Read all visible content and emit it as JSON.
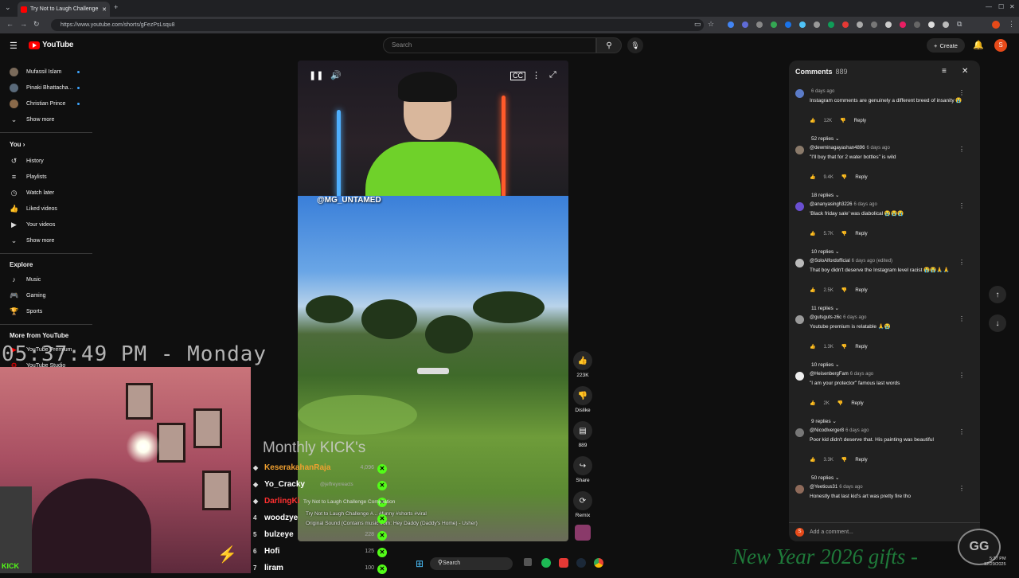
{
  "browser": {
    "tab_title": "Try Not to Laugh Challenge",
    "url": "https://www.youtube.com/shorts/gFezPsLsqu8",
    "win_controls": [
      "—",
      "☐",
      "✕"
    ]
  },
  "youtube": {
    "logo_text": "YouTube",
    "search_placeholder": "Search",
    "create_label": "Create",
    "avatar_letter": "S"
  },
  "sidebar": {
    "subs": [
      {
        "label": "Mufassil Islam"
      },
      {
        "label": "Pinaki Bhattacha..."
      },
      {
        "label": "Christian Prince"
      }
    ],
    "show_more": "Show more",
    "you_heading": "You",
    "you_items": [
      {
        "label": "History",
        "icon": "history-icon"
      },
      {
        "label": "Playlists",
        "icon": "playlists-icon"
      },
      {
        "label": "Watch later",
        "icon": "watch-later-icon"
      },
      {
        "label": "Liked videos",
        "icon": "liked-icon"
      },
      {
        "label": "Your videos",
        "icon": "your-videos-icon"
      },
      {
        "label": "Show more",
        "icon": "chevron-down-icon"
      }
    ],
    "explore_heading": "Explore",
    "explore_items": [
      {
        "label": "Music"
      },
      {
        "label": "Gaming"
      },
      {
        "label": "Sports"
      }
    ],
    "more_heading": "More from YouTube",
    "more_items": [
      {
        "label": "YouTube Premium"
      },
      {
        "label": "YouTube Studio"
      }
    ]
  },
  "video": {
    "watermark": "@MG_UNTAMED",
    "caption_line1": "Try Not to Laugh Challenge #...   #funny #shorts #viral",
    "caption_line2": "Original Sound (Contains music from: Hey Daddy (Daddy's Home) - Usher)",
    "overlay_title": "Try Not to Laugh Challenge Compilation"
  },
  "actions": {
    "like_count": "223K",
    "dislike_label": "Dislike",
    "comments_count": "889",
    "share_label": "Share",
    "remix_label": "Remix"
  },
  "comments": {
    "title": "Comments",
    "count": "889",
    "add_placeholder": "Add a comment...",
    "items": [
      {
        "user": "",
        "time": "6 days ago",
        "text": "Instagram comments are genuinely a different breed of insanity 😭",
        "likes": "12K",
        "replies": "52 replies",
        "av": "#5b7bc7"
      },
      {
        "user": "@dewminagayashan4896",
        "time": "6 days ago",
        "text": "\"I'll buy that for 2 water bottles\" is wild",
        "likes": "9.4K",
        "replies": "18 replies",
        "av": "#8a7a6a"
      },
      {
        "user": "@ananyasingh3226",
        "time": "6 days ago",
        "text": "'Black friday sale' was diabolical 😭😭😭",
        "likes": "5.7K",
        "replies": "10 replies",
        "av": "#6a4fd1"
      },
      {
        "user": "@SoloAlfordofficial",
        "time": "6 days ago (edited)",
        "text": "That boy didn't deserve the Instagram level racist 😭😭🙏🙏",
        "likes": "2.5K",
        "replies": "11 replies",
        "av": "#bbbbbb"
      },
      {
        "user": "@gutsguts-z6c",
        "time": "6 days ago",
        "text": "Youtube premium is relatable 🙏😭",
        "likes": "1.3K",
        "replies": "10 replies",
        "av": "#9a9a9a"
      },
      {
        "user": "@HeisenbergFam",
        "time": "6 days ago",
        "text": "\"I am your protector\" famous last words",
        "likes": "2K",
        "replies": "9 replies",
        "av": "#eeeeee"
      },
      {
        "user": "@Nicodlverger8",
        "time": "6 days ago",
        "text": "Poor kid didn't deserve that. His painting was beautiful",
        "likes": "3.3K",
        "replies": "50 replies",
        "av": "#777777"
      },
      {
        "user": "@Yeeticus31",
        "time": "6 days ago",
        "text": "Honestly that last kid's art was pretty fire tho",
        "likes": "",
        "replies": "",
        "av": "#8e6a5a"
      }
    ],
    "reply_label": "Reply"
  },
  "stream": {
    "clock": "05:37:49 PM - Monday",
    "kick_logo": "KICK",
    "leaderboard_title": "Monthly KICK's",
    "leaderboard": [
      {
        "rank": "◆",
        "name": "KeserakahanRaja",
        "pts": "4,096",
        "color": "#f0a030"
      },
      {
        "rank": "◆",
        "name": "Yo_Cracky",
        "pts": "",
        "color": "#ffffff"
      },
      {
        "rank": "◆",
        "name": "DarlingKi",
        "pts": "",
        "color": "#ff3030"
      },
      {
        "rank": "4",
        "name": "woodzye",
        "pts": "",
        "color": "#ffffff"
      },
      {
        "rank": "5",
        "name": "bulzeye",
        "pts": "228",
        "color": "#ffffff"
      },
      {
        "rank": "6",
        "name": "Hofi",
        "pts": "125",
        "color": "#ffffff"
      },
      {
        "rank": "7",
        "name": "liram",
        "pts": "100",
        "color": "#ffffff"
      }
    ],
    "gifts_banner": "New Year 2026 gifts -",
    "badge": "GG",
    "overlay_handle": "@jeffreyxreacts"
  },
  "taskbar": {
    "search_label": "Search",
    "time": "5:37 PM",
    "date": "12/29/2025"
  }
}
